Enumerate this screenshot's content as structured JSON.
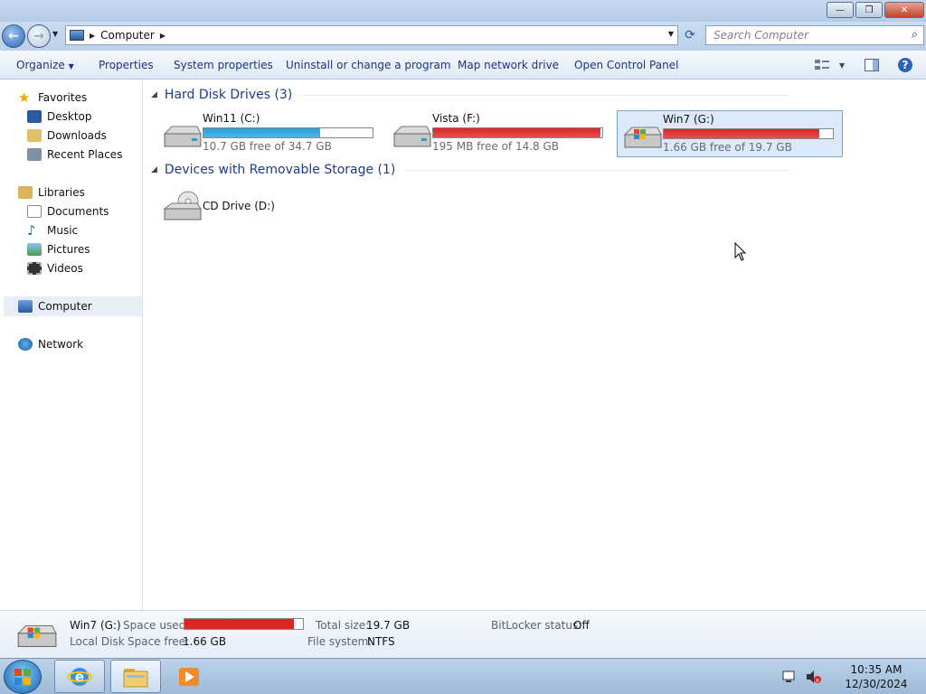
{
  "window": {
    "minimize_glyph": "—",
    "maximize_glyph": "❐",
    "close_glyph": "✕"
  },
  "address": {
    "crumbs": [
      "Computer"
    ],
    "search_placeholder": "Search Computer"
  },
  "toolbar": {
    "organize": "Organize",
    "properties": "Properties",
    "system_properties": "System properties",
    "uninstall": "Uninstall or change a program",
    "map_drive": "Map network drive",
    "control_panel": "Open Control Panel"
  },
  "nav": {
    "favorites": "Favorites",
    "desktop": "Desktop",
    "downloads": "Downloads",
    "recent": "Recent Places",
    "libraries": "Libraries",
    "documents": "Documents",
    "music": "Music",
    "pictures": "Pictures",
    "videos": "Videos",
    "computer": "Computer",
    "network": "Network"
  },
  "groups": {
    "hdd": "Hard Disk Drives (3)",
    "removable": "Devices with Removable Storage (1)"
  },
  "drives": [
    {
      "name": "Win11 (C:)",
      "free": "10.7 GB free of 34.7 GB",
      "used_fraction": 0.69,
      "color": "#26a0da",
      "selected": false
    },
    {
      "name": "Vista (F:)",
      "free": "195 MB free of 14.8 GB",
      "used_fraction": 0.99,
      "color": "#da2626",
      "selected": false
    },
    {
      "name": "Win7 (G:)",
      "free": "1.66 GB free of 19.7 GB",
      "used_fraction": 0.92,
      "color": "#da2626",
      "selected": true
    }
  ],
  "removable": [
    {
      "name": "CD Drive (D:)"
    }
  ],
  "details": {
    "name": "Win7 (G:)",
    "type": "Local Disk",
    "space_used_label": "Space used:",
    "space_used_fraction": 0.92,
    "space_free_label": "Space free:",
    "space_free": "1.66 GB",
    "total_size_label": "Total size:",
    "total_size": "19.7 GB",
    "file_system_label": "File system:",
    "file_system": "NTFS",
    "bitlocker_label": "BitLocker status:",
    "bitlocker": "Off"
  },
  "clock": {
    "time": "10:35 AM",
    "date": "12/30/2024"
  }
}
